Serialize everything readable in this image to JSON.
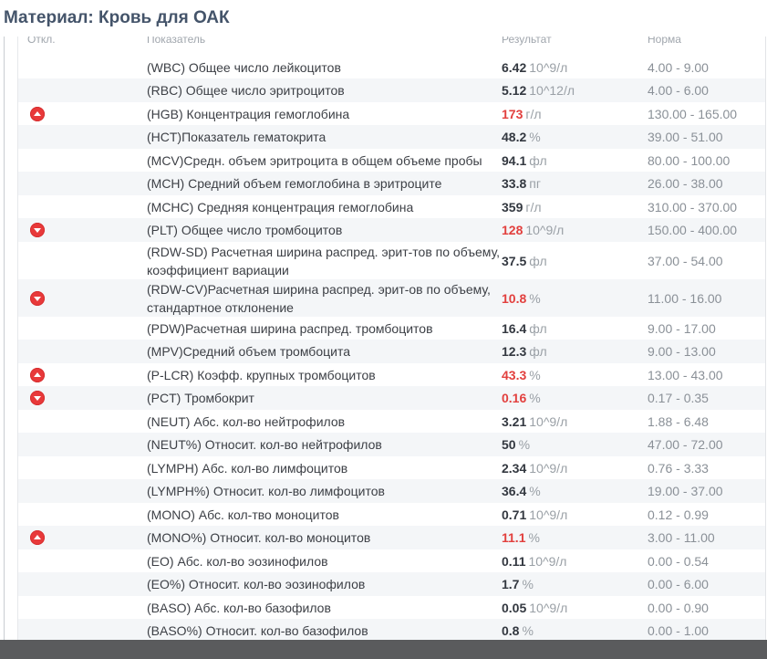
{
  "title": "Материал: Кровь для ОАК",
  "columns": {
    "flag": "Откл.",
    "name": "Показатель",
    "result": "Результат",
    "norm": "Норма"
  },
  "rows": [
    {
      "name": "(WBC) Общее число лейкоцитов",
      "value": "6.42",
      "unit": "10^9/л",
      "norm": "4.00 - 9.00",
      "flag": "",
      "abnormal": false,
      "h": 25
    },
    {
      "name": "(RBC) Общее число эритроцитов",
      "value": "5.12",
      "unit": "10^12/л",
      "norm": "4.00 - 6.00",
      "flag": "",
      "abnormal": false,
      "h": 26
    },
    {
      "name": "(HGB) Концентрация гемоглобина",
      "value": "173",
      "unit": "г/л",
      "norm": "130.00 - 165.00",
      "flag": "up",
      "abnormal": true,
      "h": 25
    },
    {
      "name": "(HCT)Показатель гематокрита",
      "value": "48.2",
      "unit": "%",
      "norm": "39.00 - 51.00",
      "flag": "",
      "abnormal": false,
      "h": 26
    },
    {
      "name": "(MCV)Средн. объем эритроцита в общем объеме пробы",
      "value": "94.1",
      "unit": "фл",
      "norm": "80.00 - 100.00",
      "flag": "",
      "abnormal": false,
      "h": 25
    },
    {
      "name": "(MCH) Средний объем гемоглобина в эритроците",
      "value": "33.8",
      "unit": "пг",
      "norm": "26.00 - 38.00",
      "flag": "",
      "abnormal": false,
      "h": 26
    },
    {
      "name": "(MCHC) Средняя концентрация гемоглобина",
      "value": "359",
      "unit": "г/л",
      "norm": "310.00 - 370.00",
      "flag": "",
      "abnormal": false,
      "h": 25
    },
    {
      "name": "(PLT) Общее число тромбоцитов",
      "value": "128",
      "unit": "10^9/л",
      "norm": "150.00 - 400.00",
      "flag": "down",
      "abnormal": true,
      "h": 26
    },
    {
      "name": "(RDW-SD) Расчетная ширина распред. эрит-тов по объему, коэффициент вариации",
      "value": "37.5",
      "unit": "фл",
      "norm": "37.00 - 54.00",
      "flag": "",
      "abnormal": false,
      "h": 41
    },
    {
      "name": "(RDW-CV)Расчетная ширина распред. эрит-ов по объему, стандартное отклонение",
      "value": "10.8",
      "unit": "%",
      "norm": "11.00 - 16.00",
      "flag": "down",
      "abnormal": true,
      "h": 41
    },
    {
      "name": "(PDW)Расчетная ширина распред. тромбоцитов",
      "value": "16.4",
      "unit": "фл",
      "norm": "9.00 - 17.00",
      "flag": "",
      "abnormal": false,
      "h": 25
    },
    {
      "name": "(MPV)Средний объем тромбоцита",
      "value": "12.3",
      "unit": "фл",
      "norm": "9.00 - 13.00",
      "flag": "",
      "abnormal": false,
      "h": 26
    },
    {
      "name": "(P-LCR) Коэфф. крупных тромбоцитов",
      "value": "43.3",
      "unit": "%",
      "norm": "13.00 - 43.00",
      "flag": "up",
      "abnormal": true,
      "h": 25
    },
    {
      "name": "(PCT) Тромбокрит",
      "value": "0.16",
      "unit": "%",
      "norm": "0.17 - 0.35",
      "flag": "down",
      "abnormal": true,
      "h": 26
    },
    {
      "name": "(NEUT) Абс. кол-во нейтрофилов",
      "value": "3.21",
      "unit": "10^9/л",
      "norm": "1.88 - 6.48",
      "flag": "",
      "abnormal": false,
      "h": 25
    },
    {
      "name": "(NEUT%) Относит. кол-во нейтрофилов",
      "value": "50",
      "unit": "%",
      "norm": "47.00 - 72.00",
      "flag": "",
      "abnormal": false,
      "h": 26
    },
    {
      "name": "(LYMPH) Абс. кол-во лимфоцитов",
      "value": "2.34",
      "unit": "10^9/л",
      "norm": "0.76 - 3.33",
      "flag": "",
      "abnormal": false,
      "h": 25
    },
    {
      "name": "(LYMPH%) Относит. кол-во лимфоцитов",
      "value": "36.4",
      "unit": "%",
      "norm": "19.00 - 37.00",
      "flag": "",
      "abnormal": false,
      "h": 26
    },
    {
      "name": "(MONO) Абс. кол-тво моноцитов",
      "value": "0.71",
      "unit": "10^9/л",
      "norm": "0.12 - 0.99",
      "flag": "",
      "abnormal": false,
      "h": 25
    },
    {
      "name": "(MONO%) Относит. кол-во моноцитов",
      "value": "11.1",
      "unit": "%",
      "norm": "3.00 - 11.00",
      "flag": "up",
      "abnormal": true,
      "h": 26
    },
    {
      "name": "(EO) Абс. кол-во эозинофилов",
      "value": "0.11",
      "unit": "10^9/л",
      "norm": "0.00 - 0.54",
      "flag": "",
      "abnormal": false,
      "h": 25
    },
    {
      "name": "(EO%) Относит. кол-во эозинофилов",
      "value": "1.7",
      "unit": "%",
      "norm": "0.00 - 6.00",
      "flag": "",
      "abnormal": false,
      "h": 26
    },
    {
      "name": "(BASO) Абс. кол-во базофилов",
      "value": "0.05",
      "unit": "10^9/л",
      "norm": "0.00 - 0.90",
      "flag": "",
      "abnormal": false,
      "h": 25
    },
    {
      "name": "(BASO%) Относит. кол-во базофилов",
      "value": "0.8",
      "unit": "%",
      "norm": "0.00 - 1.00",
      "flag": "",
      "abnormal": false,
      "h": 26
    }
  ],
  "icons": {
    "up": "arrow-up-circle-icon",
    "down": "arrow-down-circle-icon"
  },
  "colors": {
    "abnormal": "#e2403e",
    "flag": "#e8393a",
    "title": "#44546a",
    "stripe": "#f4f6f8"
  }
}
